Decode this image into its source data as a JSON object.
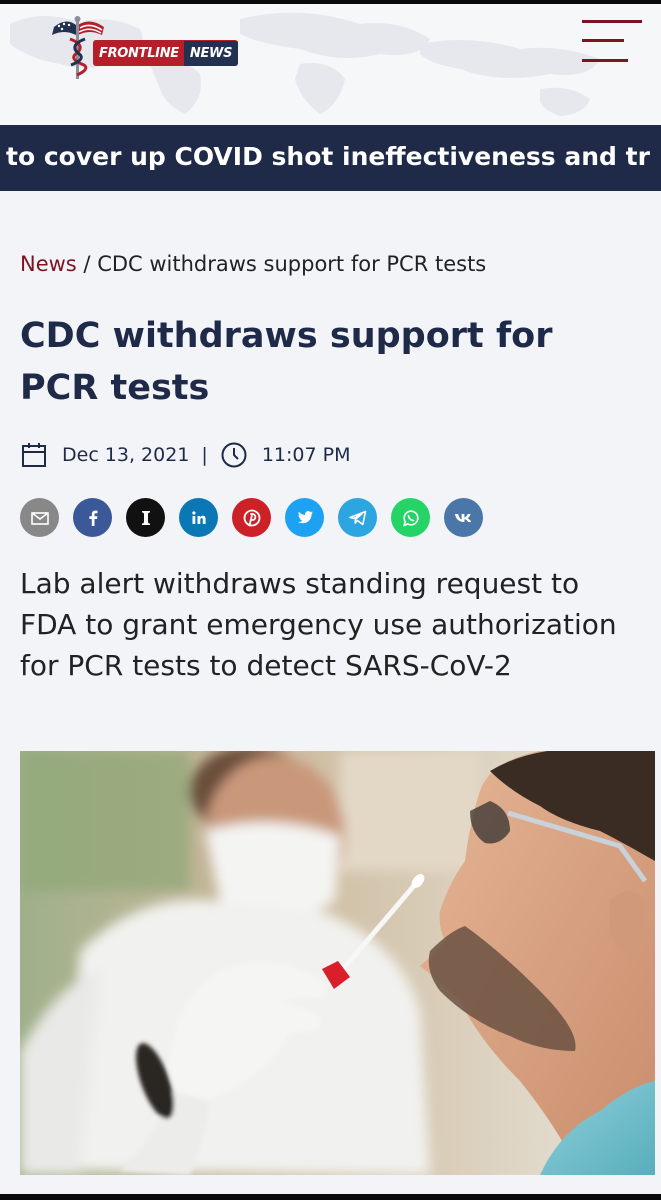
{
  "header": {
    "logo_word_1": "FRONTLINE",
    "logo_word_2": "NEWS",
    "menu_icon": "hamburger-menu-icon"
  },
  "ticker": {
    "text": "to cover up COVID shot ineffectiveness and tr"
  },
  "breadcrumb": {
    "home": "News",
    "separator": " / ",
    "current": "CDC withdraws support for PCR tests"
  },
  "article": {
    "title": "CDC withdraws support for PCR tests",
    "date": "Dec 13, 2021",
    "divider": "|",
    "time": "11:07 PM",
    "subheadline": "Lab alert withdraws standing request to FDA to grant emergency use authorization for PCR tests to detect SARS-CoV-2"
  },
  "share_buttons": [
    {
      "icon": "email-icon",
      "color": "#888888"
    },
    {
      "icon": "facebook-icon",
      "color": "#3b5998"
    },
    {
      "icon": "instapaper-icon",
      "color": "#111111"
    },
    {
      "icon": "linkedin-icon",
      "color": "#0b77b5"
    },
    {
      "icon": "pinterest-icon",
      "color": "#cc2127"
    },
    {
      "icon": "twitter-icon",
      "color": "#1da1f2"
    },
    {
      "icon": "telegram-icon",
      "color": "#2ca5e0"
    },
    {
      "icon": "whatsapp-icon",
      "color": "#25d366"
    },
    {
      "icon": "vk-icon",
      "color": "#4a76a8"
    }
  ],
  "colors": {
    "navy": "#1f2a48",
    "maroon": "#7d1422",
    "page_bg": "#f3f4f8"
  }
}
